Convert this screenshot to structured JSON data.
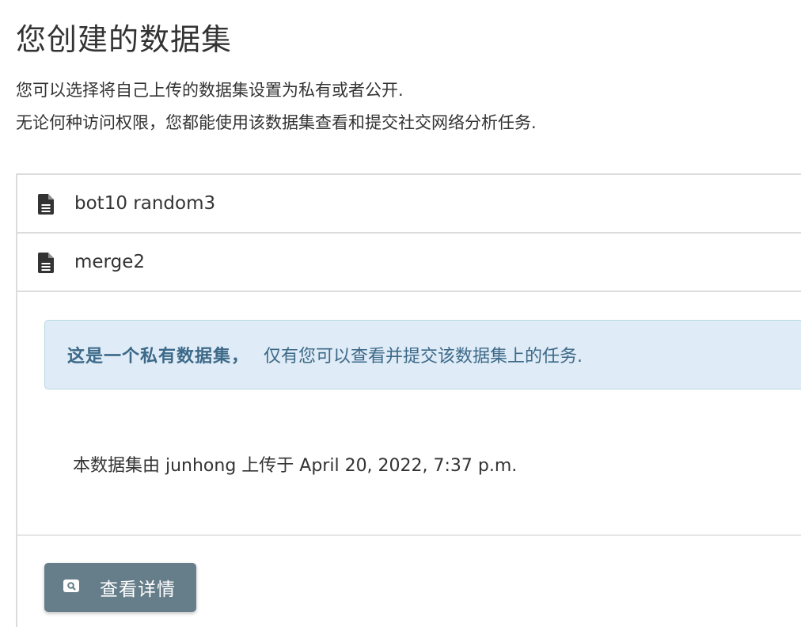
{
  "header": {
    "title": "您创建的数据集",
    "description_line1": "您可以选择将自己上传的数据集设置为私有或者公开.",
    "description_line2": "无论何种访问权限，您都能使用该数据集查看和提交社交网络分析任务."
  },
  "datasets": [
    {
      "name": "bot10 random3",
      "icon": "file-text-icon"
    },
    {
      "name": "merge2",
      "icon": "file-text-icon"
    }
  ],
  "detail": {
    "alert_strong": "这是一个私有数据集，",
    "alert_text": "仅有您可以查看并提交该数据集上的任务.",
    "upload_info": "本数据集由 junhong 上传于 April 20, 2022, 7:37 p.m.",
    "view_button_label": "查看详情",
    "view_button_icon": "search-icon"
  },
  "colors": {
    "alert_background": "#dfebf6",
    "alert_text": "#3c6988",
    "button_background": "#667d8a"
  }
}
